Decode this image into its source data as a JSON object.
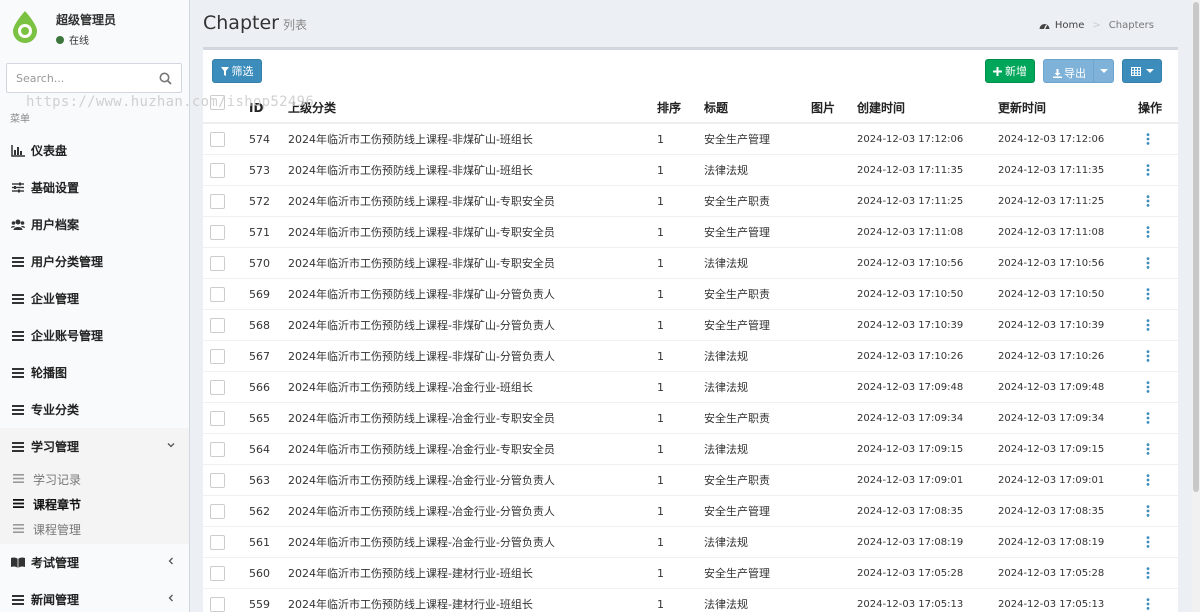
{
  "user": {
    "name": "超级管理员",
    "status": "在线",
    "status_color": "#3c763d"
  },
  "search": {
    "placeholder": "Search..."
  },
  "menu_header": "菜单",
  "menu": [
    {
      "label": "仪表盘",
      "icon": "bar-chart-icon"
    },
    {
      "label": "基础设置",
      "icon": "sliders-icon"
    },
    {
      "label": "用户档案",
      "icon": "users-icon"
    },
    {
      "label": "用户分类管理",
      "icon": "bars-icon"
    },
    {
      "label": "企业管理",
      "icon": "bars-icon"
    },
    {
      "label": "企业账号管理",
      "icon": "bars-icon"
    },
    {
      "label": "轮播图",
      "icon": "bars-icon"
    },
    {
      "label": "专业分类",
      "icon": "bars-icon"
    },
    {
      "label": "学习管理",
      "icon": "bars-icon",
      "expanded": true,
      "children": [
        {
          "label": "学习记录"
        },
        {
          "label": "课程章节",
          "current": true
        },
        {
          "label": "课程管理"
        }
      ]
    },
    {
      "label": "考试管理",
      "icon": "book-icon"
    },
    {
      "label": "新闻管理",
      "icon": "bars-icon"
    }
  ],
  "header": {
    "title": "Chapter",
    "subtitle": "列表"
  },
  "breadcrumb": {
    "home": "Home",
    "current": "Chapters"
  },
  "toolbar": {
    "filter": "筛选",
    "add": "新增",
    "export": "导出"
  },
  "colors": {
    "primary": "#3c8dbc",
    "success": "#00a65a",
    "export": "#7fb2d8"
  },
  "watermark": "https://www.huzhan.com/ishop52496",
  "table": {
    "columns": {
      "id": "ID",
      "parent": "上级分类",
      "sort": "排序",
      "title": "标题",
      "image": "图片",
      "created": "创建时间",
      "updated": "更新时间",
      "ops": "操作"
    },
    "rows": [
      {
        "id": "574",
        "parent": "2024年临沂市工伤预防线上课程-非煤矿山-班组长",
        "sort": "1",
        "title": "安全生产管理",
        "created": "2024-12-03 17:12:06",
        "updated": "2024-12-03 17:12:06"
      },
      {
        "id": "573",
        "parent": "2024年临沂市工伤预防线上课程-非煤矿山-班组长",
        "sort": "1",
        "title": "法律法规",
        "created": "2024-12-03 17:11:35",
        "updated": "2024-12-03 17:11:35"
      },
      {
        "id": "572",
        "parent": "2024年临沂市工伤预防线上课程-非煤矿山-专职安全员",
        "sort": "1",
        "title": "安全生产职责",
        "created": "2024-12-03 17:11:25",
        "updated": "2024-12-03 17:11:25"
      },
      {
        "id": "571",
        "parent": "2024年临沂市工伤预防线上课程-非煤矿山-专职安全员",
        "sort": "1",
        "title": "安全生产管理",
        "created": "2024-12-03 17:11:08",
        "updated": "2024-12-03 17:11:08"
      },
      {
        "id": "570",
        "parent": "2024年临沂市工伤预防线上课程-非煤矿山-专职安全员",
        "sort": "1",
        "title": "法律法规",
        "created": "2024-12-03 17:10:56",
        "updated": "2024-12-03 17:10:56"
      },
      {
        "id": "569",
        "parent": "2024年临沂市工伤预防线上课程-非煤矿山-分管负责人",
        "sort": "1",
        "title": "安全生产职责",
        "created": "2024-12-03 17:10:50",
        "updated": "2024-12-03 17:10:50"
      },
      {
        "id": "568",
        "parent": "2024年临沂市工伤预防线上课程-非煤矿山-分管负责人",
        "sort": "1",
        "title": "安全生产管理",
        "created": "2024-12-03 17:10:39",
        "updated": "2024-12-03 17:10:39"
      },
      {
        "id": "567",
        "parent": "2024年临沂市工伤预防线上课程-非煤矿山-分管负责人",
        "sort": "1",
        "title": "法律法规",
        "created": "2024-12-03 17:10:26",
        "updated": "2024-12-03 17:10:26"
      },
      {
        "id": "566",
        "parent": "2024年临沂市工伤预防线上课程-冶金行业-班组长",
        "sort": "1",
        "title": "法律法规",
        "created": "2024-12-03 17:09:48",
        "updated": "2024-12-03 17:09:48"
      },
      {
        "id": "565",
        "parent": "2024年临沂市工伤预防线上课程-冶金行业-专职安全员",
        "sort": "1",
        "title": "安全生产职责",
        "created": "2024-12-03 17:09:34",
        "updated": "2024-12-03 17:09:34"
      },
      {
        "id": "564",
        "parent": "2024年临沂市工伤预防线上课程-冶金行业-专职安全员",
        "sort": "1",
        "title": "法律法规",
        "created": "2024-12-03 17:09:15",
        "updated": "2024-12-03 17:09:15"
      },
      {
        "id": "563",
        "parent": "2024年临沂市工伤预防线上课程-冶金行业-分管负责人",
        "sort": "1",
        "title": "安全生产职责",
        "created": "2024-12-03 17:09:01",
        "updated": "2024-12-03 17:09:01"
      },
      {
        "id": "562",
        "parent": "2024年临沂市工伤预防线上课程-冶金行业-分管负责人",
        "sort": "1",
        "title": "安全生产管理",
        "created": "2024-12-03 17:08:35",
        "updated": "2024-12-03 17:08:35"
      },
      {
        "id": "561",
        "parent": "2024年临沂市工伤预防线上课程-冶金行业-分管负责人",
        "sort": "1",
        "title": "法律法规",
        "created": "2024-12-03 17:08:19",
        "updated": "2024-12-03 17:08:19"
      },
      {
        "id": "560",
        "parent": "2024年临沂市工伤预防线上课程-建材行业-班组长",
        "sort": "1",
        "title": "安全生产管理",
        "created": "2024-12-03 17:05:28",
        "updated": "2024-12-03 17:05:28"
      },
      {
        "id": "559",
        "parent": "2024年临沂市工伤预防线上课程-建材行业-班组长",
        "sort": "1",
        "title": "法律法规",
        "created": "2024-12-03 17:05:13",
        "updated": "2024-12-03 17:05:13"
      }
    ]
  }
}
